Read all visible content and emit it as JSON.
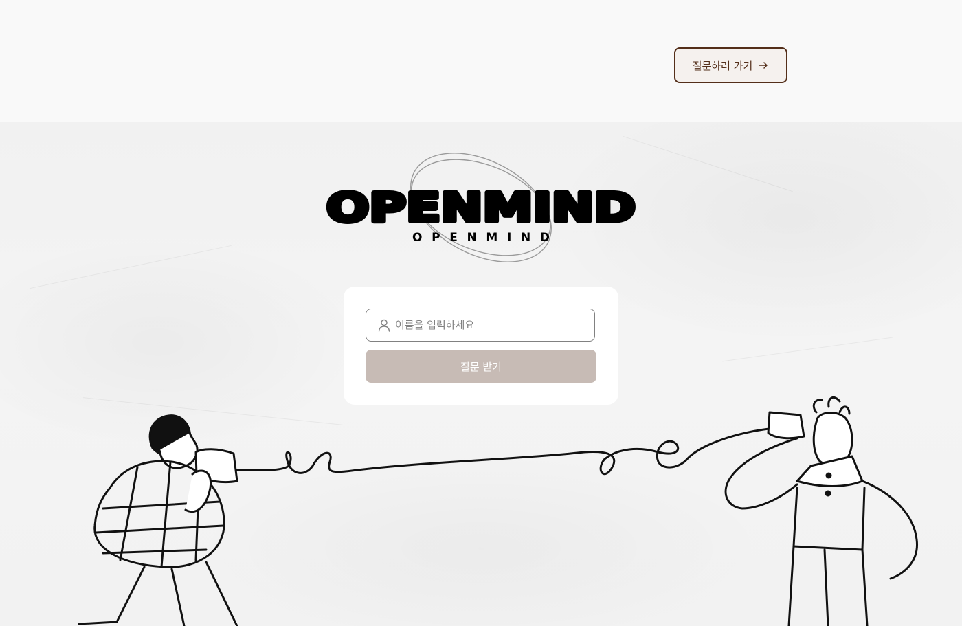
{
  "header": {
    "goto_question_label": "질문하러 가기",
    "goto_question_icon": "arrow-right-icon"
  },
  "brand": {
    "logo_wordmark": "OPENMIND",
    "logo_subtitle": "OPENMIND"
  },
  "form": {
    "name_placeholder": "이름을 입력하세요",
    "name_value": "",
    "name_icon": "person-icon",
    "submit_label": "질문 받기"
  },
  "colors": {
    "brand_brown": "#542f1a",
    "button_disabled": "#c7bbb5",
    "background": "#f9f9f9"
  }
}
